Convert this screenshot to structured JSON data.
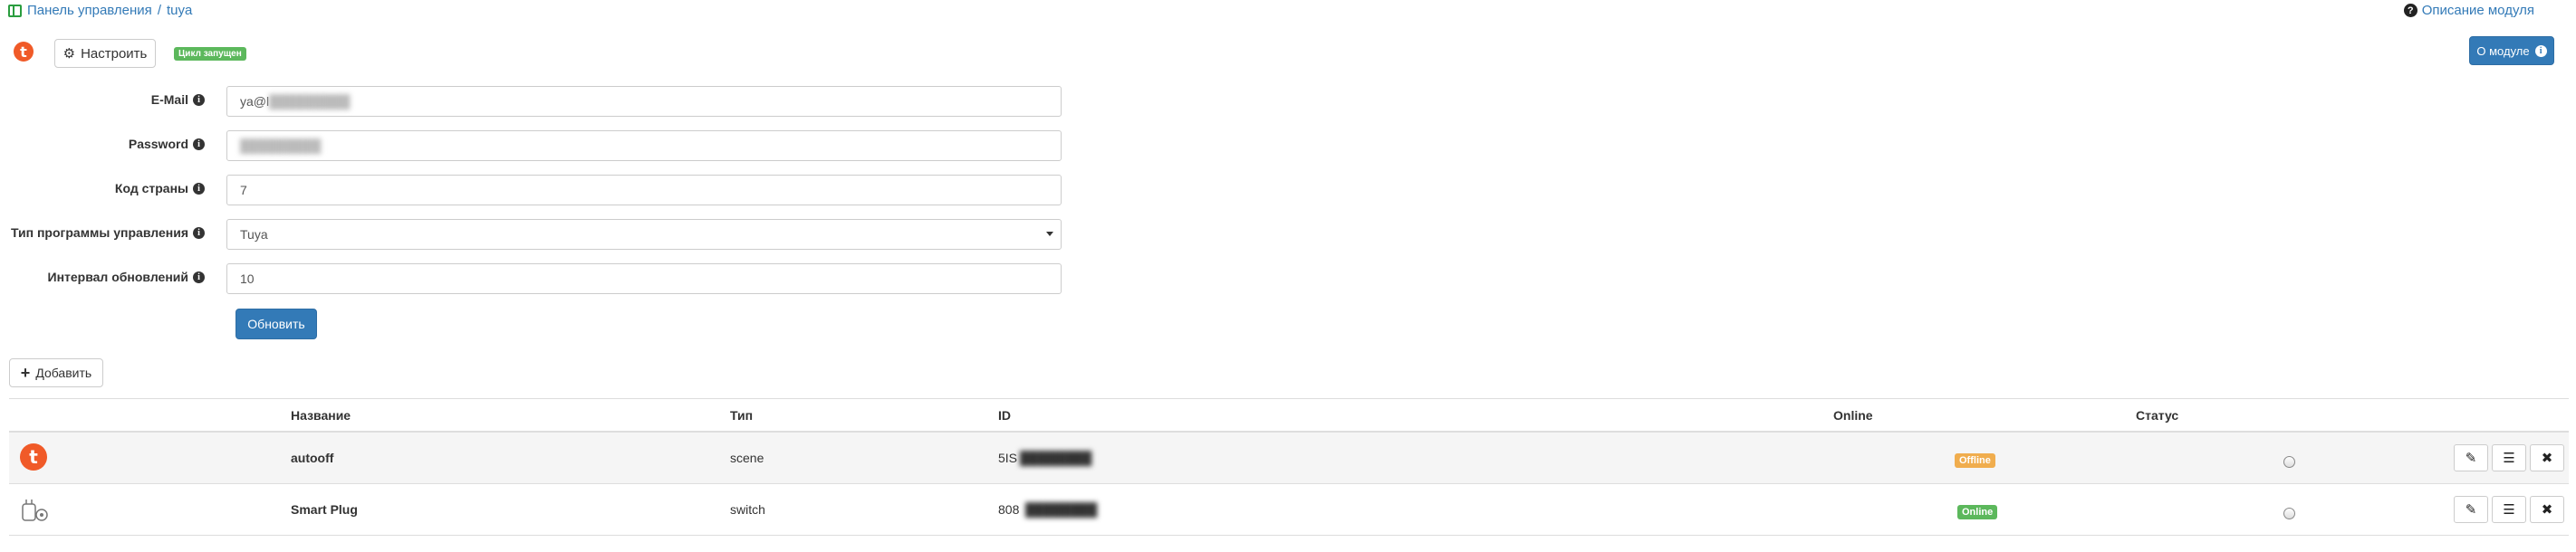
{
  "breadcrumb": {
    "root": "Панель управления",
    "separator": "/",
    "current": "tuya"
  },
  "help_link": "Описание модуля",
  "toolbar": {
    "configure_label": "Настроить",
    "status_badge": "Цикл запущен",
    "about_label": "О модуле"
  },
  "form": {
    "email": {
      "label": "E-Mail",
      "value": "ya@l"
    },
    "password": {
      "label": "Password",
      "value": ""
    },
    "country_code": {
      "label": "Код страны",
      "value": "7"
    },
    "app_type": {
      "label": "Тип программы управления",
      "value": "Tuya"
    },
    "interval": {
      "label": "Интервал обновлений",
      "value": "10"
    },
    "submit_label": "Обновить"
  },
  "add_label": "Добавить",
  "table": {
    "headers": {
      "name": "Название",
      "type": "Тип",
      "id": "ID",
      "online": "Online",
      "status": "Статус"
    },
    "rows": [
      {
        "name": "autooff",
        "type": "scene",
        "id": "5IS",
        "online": "Offline",
        "icon": "tuya-logo"
      },
      {
        "name": "Smart Plug",
        "type": "switch",
        "id": "808",
        "online": "Online",
        "icon": "smart-plug"
      }
    ]
  },
  "colors": {
    "primary": "#337ab7",
    "success": "#5cb85c",
    "warning": "#f0ad4e",
    "brand": "#f05a28"
  }
}
